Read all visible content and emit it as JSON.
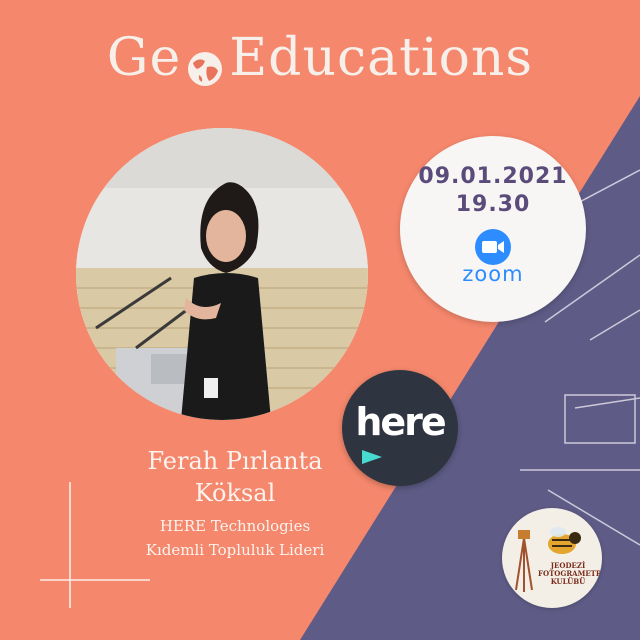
{
  "title": {
    "part1": "Ge",
    "part2": "Educations",
    "globe_icon": "globe-icon"
  },
  "event": {
    "date": "09.01.2021",
    "time": "19.30",
    "platform_label": "zoom",
    "platform_icon": "zoom-camera-icon"
  },
  "speaker": {
    "name_line1": "Ferah Pırlanta",
    "name_line2": "Köksal",
    "org_line1": "HERE Technologies",
    "org_line2": "Kıdemli Topluluk Lideri"
  },
  "partner": {
    "logo_text": "here",
    "logo_icon": "here-logo-icon"
  },
  "club": {
    "line1": "JEODEZİ",
    "line2": "FOTOGRAMETRİ",
    "line3": "KULÜBÜ"
  },
  "colors": {
    "coral": "#f4876c",
    "purple": "#5e5b86",
    "cream": "#f7efe9",
    "zoom_blue": "#2d8cff",
    "date_text": "#5a4b7a",
    "here_dark": "#2f3540",
    "here_cyan": "#48dad0"
  }
}
